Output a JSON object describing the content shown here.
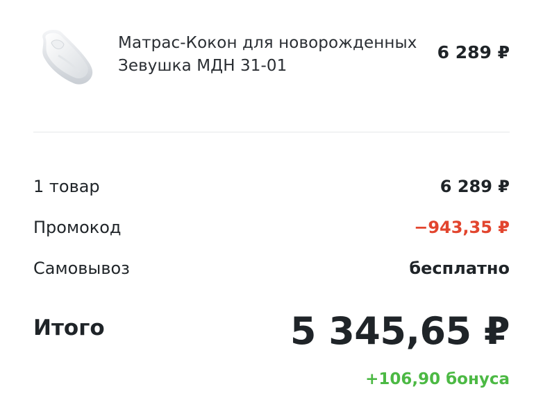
{
  "product": {
    "name_line1": "Матрас-Кокон для новорожденных",
    "name_line2": "Зевушка МДН 31-01",
    "price": "6 289 ₽",
    "image": "white-mattress-cocoon-thumbnail"
  },
  "summary": {
    "items_label": "1 товар",
    "items_value": "6 289 ₽",
    "promo_label": "Промокод",
    "promo_value": "−943,35 ₽",
    "pickup_label": "Самовывоз",
    "pickup_value": "бесплатно"
  },
  "total": {
    "label": "Итого",
    "value": "5 345,65 ₽",
    "bonus": "+106,90 бонуса"
  },
  "colors": {
    "promo": "#e2452e",
    "bonus": "#4cb944",
    "text": "#1f2428",
    "divider": "#e6e7ea"
  }
}
